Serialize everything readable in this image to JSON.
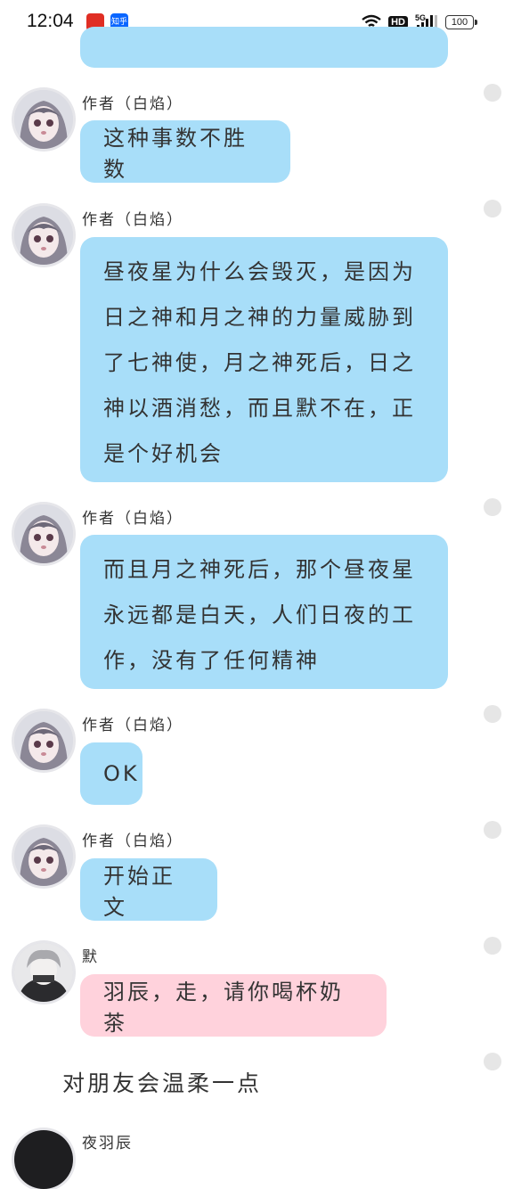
{
  "status_bar": {
    "time": "12:04",
    "app_icons": [
      {
        "name": "pinduoduo-app-icon",
        "color": "#e02e24",
        "label": ""
      },
      {
        "name": "zhihu-app-icon",
        "color": "#0a66ff",
        "label": "知乎"
      }
    ],
    "hd_label": "HD",
    "network_label": "5G",
    "battery_level": "100",
    "icons": [
      "wifi-icon",
      "hd-icon",
      "signal-icon",
      "battery-icon"
    ]
  },
  "colors": {
    "author_bubble": "#a8def9",
    "mo_bubble": "#ffd2dc",
    "dot": "#e6e6e6"
  },
  "messages": [
    {
      "sender": "作者（白焰）",
      "text": "这种事数不胜数",
      "style": "blue"
    },
    {
      "sender": "作者（白焰）",
      "text": "昼夜星为什么会毁灭，是因为日之神和月之神的力量威胁到了七神使，月之神死后，日之神以酒消愁，而且默不在，正是个好机会",
      "style": "blue"
    },
    {
      "sender": "作者（白焰）",
      "text": "而且月之神死后，那个昼夜星永远都是白天，人们日夜的工作，没有了任何精神",
      "style": "blue"
    },
    {
      "sender": "作者（白焰）",
      "text": "OK",
      "style": "blue"
    },
    {
      "sender": "作者（白焰）",
      "text": "开始正文",
      "style": "blue"
    },
    {
      "sender": "默",
      "text": "羽辰，走，请你喝杯奶茶",
      "style": "pink"
    }
  ],
  "narration": "对朋友会温柔一点",
  "partial_sender": "夜羽辰"
}
